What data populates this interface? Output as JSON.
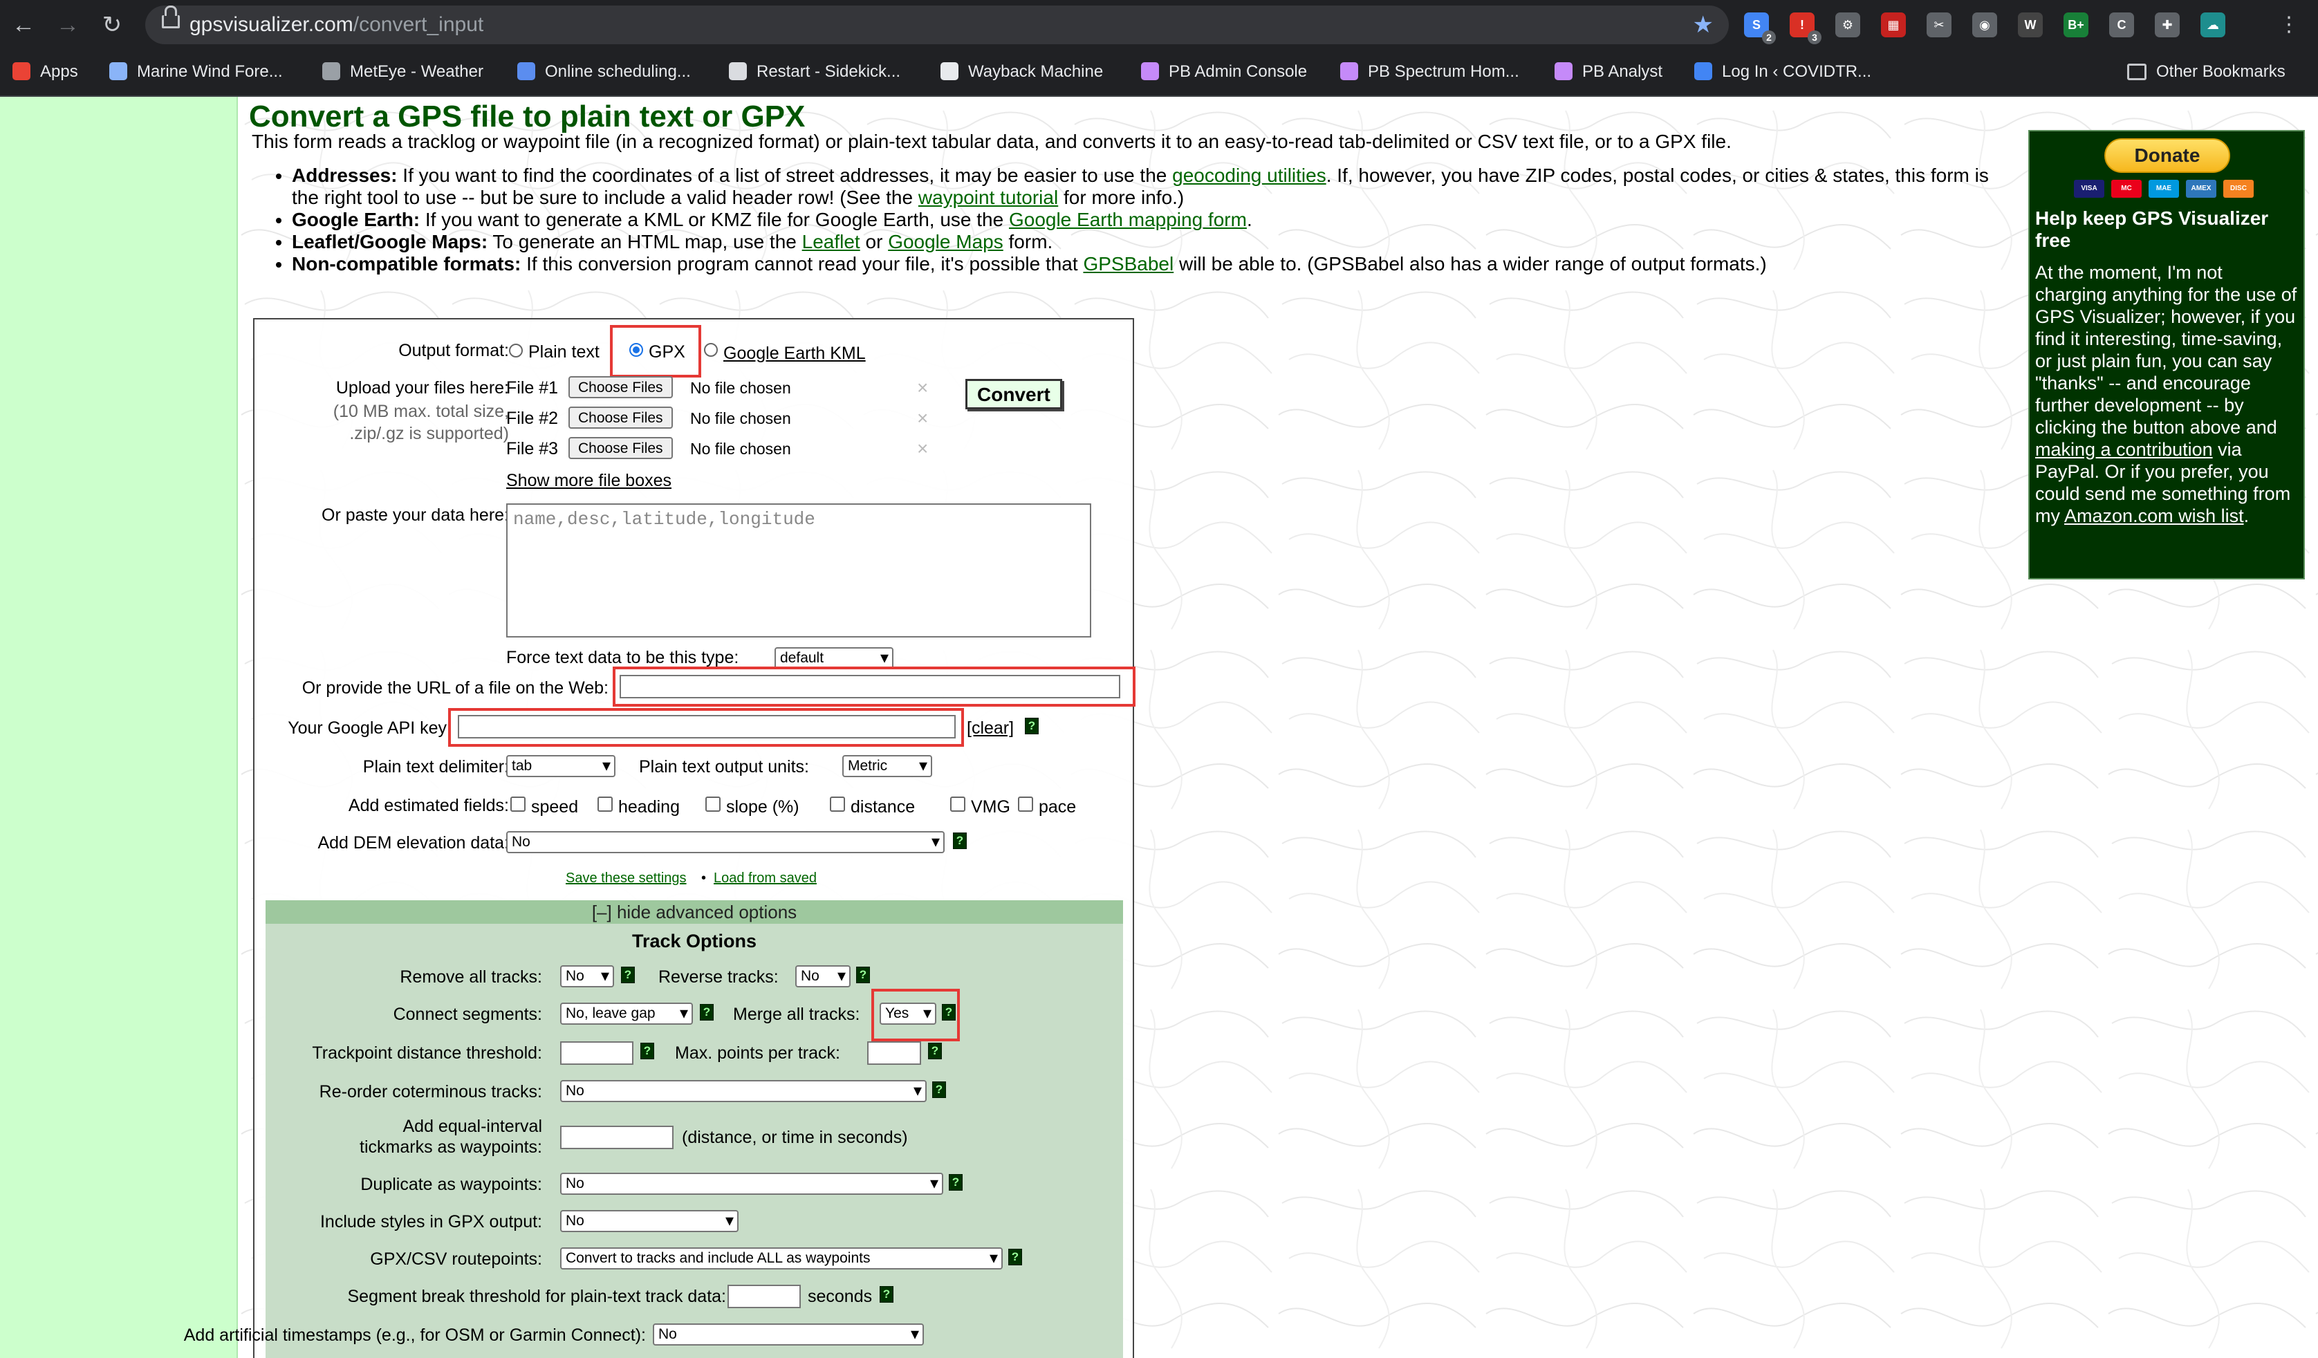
{
  "browser": {
    "url_host": "gpsvisualizer.com",
    "url_path": "/convert_input",
    "extensions": [
      {
        "name": "ext-1-icon",
        "glyph": "S",
        "color": "#4285f4",
        "badge": "2"
      },
      {
        "name": "ext-2-icon",
        "glyph": "!",
        "color": "#d93025",
        "badge": "3"
      },
      {
        "name": "ext-3-icon",
        "glyph": "⚙",
        "color": "#5f6368",
        "badge": ""
      },
      {
        "name": "ext-4-icon",
        "glyph": "▦",
        "color": "#c5221f",
        "badge": ""
      },
      {
        "name": "ext-5-icon",
        "glyph": "✂",
        "color": "#5f6368",
        "badge": ""
      },
      {
        "name": "ext-6-icon",
        "glyph": "◉",
        "color": "#5f6368",
        "badge": ""
      },
      {
        "name": "ext-7-icon",
        "glyph": "W",
        "color": "#444444",
        "badge": ""
      },
      {
        "name": "ext-8-icon",
        "glyph": "B+",
        "color": "#188038",
        "badge": ""
      },
      {
        "name": "ext-9-icon",
        "glyph": "C",
        "color": "#5f6368",
        "badge": ""
      },
      {
        "name": "ext-10-icon",
        "glyph": "✚",
        "color": "#5f6368",
        "badge": ""
      },
      {
        "name": "ext-11-icon",
        "glyph": "☁",
        "color": "#1e8e8e",
        "badge": ""
      }
    ],
    "bookmarks": [
      {
        "label": "Apps",
        "color": "#ea4335"
      },
      {
        "label": "Marine Wind Fore...",
        "color": "#8ab4f8"
      },
      {
        "label": "MetEye - Weather",
        "color": "#9aa0a6"
      },
      {
        "label": "Online scheduling...",
        "color": "#5b8def"
      },
      {
        "label": "Restart - Sidekick...",
        "color": "#dadce0"
      },
      {
        "label": "Wayback Machine",
        "color": "#e8eaed"
      },
      {
        "label": "PB Admin Console",
        "color": "#c58af9"
      },
      {
        "label": "PB Spectrum Hom...",
        "color": "#c58af9"
      },
      {
        "label": "PB Analyst",
        "color": "#c58af9"
      },
      {
        "label": "Log In ‹ COVIDTR...",
        "color": "#4285f4"
      }
    ],
    "other_bookmarks": "Other Bookmarks"
  },
  "header": {
    "title": "Convert a GPS file to plain text or GPX",
    "intro": "This form reads a tracklog or waypoint file (in a recognized format) or plain-text tabular data, and converts it to an easy-to-read tab-delimited or CSV text file, or to a GPX file."
  },
  "notes": {
    "addresses": {
      "label": "Addresses:",
      "t1": " If you want to find the coordinates of a list of street addresses, it may be easier to use the ",
      "link1": "geocoding utilities",
      "t2": ". If, however, you have ZIP codes, postal codes, or cities & states, this form is the right tool to use -- but be sure to include a valid header row! (See the ",
      "link2": "waypoint tutorial",
      "t3": " for more info.)"
    },
    "earth": {
      "label": "Google Earth:",
      "t1": " If you want to generate a KML or KMZ file for Google Earth, use the ",
      "link1": "Google Earth mapping form",
      "t2": "."
    },
    "leaflet": {
      "label": "Leaflet/Google Maps:",
      "t1": " To generate an HTML map, use the ",
      "link1": "Leaflet",
      "t2": " or ",
      "link2": "Google Maps",
      "t3": " form."
    },
    "noncompat": {
      "label": "Non-compatible formats:",
      "t1": " If this conversion program cannot read your file, it's possible that ",
      "link1": "GPSBabel",
      "t2": " will be able to. (GPSBabel also has a wider range of output formats.)"
    }
  },
  "form": {
    "output_format_label": "Output format:",
    "format_plain": "Plain text",
    "format_gpx": "GPX",
    "format_kml": "Google Earth KML",
    "upload_label": "Upload your files here:",
    "upload_note1": "(10 MB max. total size,",
    "upload_note2": ".zip/.gz is supported)",
    "files": [
      {
        "label": "File #1",
        "button": "Choose Files",
        "status": "No file chosen"
      },
      {
        "label": "File #2",
        "button": "Choose Files",
        "status": "No file chosen"
      },
      {
        "label": "File #3",
        "button": "Choose Files",
        "status": "No file chosen"
      }
    ],
    "show_more": "Show more file boxes",
    "convert": "Convert",
    "paste_label": "Or paste your data here:",
    "paste_placeholder": "name,desc,latitude,longitude",
    "force_type_label": "Force text data to be this type:",
    "force_type_value": "default",
    "url_label": "Or provide the URL of a file on the Web:",
    "url_value": "",
    "api_label": "Your Google API key",
    "api_value": "",
    "clear": "[clear]",
    "delimiter_label": "Plain text delimiter:",
    "delimiter_value": "tab",
    "units_label": "Plain text output units:",
    "units_value": "Metric",
    "estimated_label": "Add estimated fields:",
    "estimated": [
      "speed",
      "heading",
      "slope (%)",
      "distance",
      "VMG",
      "pace"
    ],
    "dem_label": "Add DEM elevation data:",
    "dem_value": "No",
    "save_settings": "Save these settings",
    "bullet": "•",
    "load_saved": "Load from saved",
    "help_glyph": "?"
  },
  "advanced": {
    "toggle": "[–] hide advanced options",
    "section_title": "Track Options",
    "remove_tracks_label": "Remove all tracks:",
    "remove_tracks_value": "No",
    "reverse_tracks_label": "Reverse tracks:",
    "reverse_tracks_value": "No",
    "connect_label": "Connect segments:",
    "connect_value": "No, leave gap",
    "merge_label": "Merge all tracks:",
    "merge_value": "Yes",
    "distance_threshold_label": "Trackpoint distance threshold:",
    "max_points_label": "Max. points per track:",
    "reorder_label": "Re-order coterminous tracks:",
    "reorder_value": "No",
    "tickmarks_label1": "Add equal-interval",
    "tickmarks_label2": "tickmarks as waypoints:",
    "tickmarks_note": "(distance, or time in seconds)",
    "duplicate_label": "Duplicate as waypoints:",
    "duplicate_value": "No",
    "styles_label": "Include styles in GPX output:",
    "styles_value": "No",
    "routepoints_label": "GPX/CSV routepoints:",
    "routepoints_value": "Convert to tracks and include ALL as waypoints",
    "segment_break_label": "Segment break threshold for plain-text track data:",
    "segment_break_unit": "seconds",
    "timestamps_label": "Add artificial timestamps (e.g., for OSM or Garmin Connect):",
    "timestamps_value": "No"
  },
  "sidebar": {
    "donate": "Donate",
    "cards": [
      {
        "label": "VISA",
        "color": "#1a1f71"
      },
      {
        "label": "MC",
        "color": "#eb001b"
      },
      {
        "label": "MAE",
        "color": "#0099df"
      },
      {
        "label": "AMEX",
        "color": "#2e77bb"
      },
      {
        "label": "DISC",
        "color": "#f58220"
      }
    ],
    "title": "Help keep GPS Visualizer free",
    "t1": "At the moment, I'm not charging anything for the use of GPS Visualizer; however, if you find it interesting, time-saving, or just plain fun, you can say \"thanks\" -- and encourage further development -- by clicking the button above and ",
    "link1": "making a contribution",
    "t2": " via PayPal. Or if you prefer, you could send me something from my ",
    "link2": "Amazon.com wish list",
    "t3": "."
  }
}
